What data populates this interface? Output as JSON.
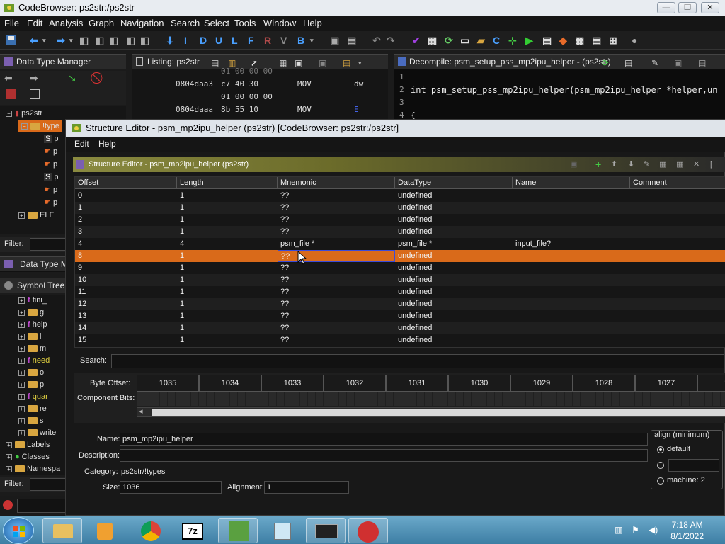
{
  "window": {
    "title": "CodeBrowser: ps2str:/ps2str"
  },
  "menubar": {
    "items": [
      "File",
      "Edit",
      "Analysis",
      "Graph",
      "Navigation",
      "Search",
      "Select",
      "Tools",
      "Window",
      "Help"
    ]
  },
  "toolbar": {
    "nav_letters": [
      "I",
      "D",
      "U",
      "L",
      "F",
      "R",
      "V",
      "B"
    ]
  },
  "panels": {
    "data_type_manager": "Data Type Manager",
    "data_type_manager_collapsed": "Data Type Ma",
    "listing": "Listing:  ps2str",
    "decompile": "Decompile: psm_setup_pss_mp2ipu_helper - (ps2str)",
    "symbol_tree": "Symbol Tree"
  },
  "dtm_tree": {
    "root": "ps2str",
    "types": "!type",
    "leaf_labels": [
      "p",
      "p",
      "p",
      "p",
      "p",
      "p"
    ],
    "elf": "ELF",
    "filter_label": "Filter:"
  },
  "listing": {
    "lines": [
      {
        "addr": "",
        "bytes": "01 00 00 00",
        "mnem": "",
        "op": ""
      },
      {
        "addr": "0804daa3",
        "bytes": "c7 40 30",
        "mnem": "MOV",
        "op": "dw"
      },
      {
        "addr": "",
        "bytes": "01 00 00 00",
        "mnem": "",
        "op": ""
      },
      {
        "addr": "0804daaa",
        "bytes": "8b 55 10",
        "mnem": "MOV",
        "op": "E"
      }
    ]
  },
  "decompile": {
    "lines": [
      {
        "no": "1",
        "code": ""
      },
      {
        "no": "2",
        "code": "int psm_setup_pss_mp2ipu_helper(psm_mp2ipu_helper *helper,un"
      },
      {
        "no": "3",
        "code": ""
      },
      {
        "no": "4",
        "code": "{"
      }
    ]
  },
  "symbol_tree": {
    "items": [
      "fini_",
      "g",
      "help",
      "i",
      "m",
      "need",
      "o",
      "p",
      "quar",
      "re",
      "s",
      "write",
      "Labels",
      "Classes",
      "Namespa"
    ],
    "filter_label": "Filter:"
  },
  "dialog": {
    "title": "Structure Editor - psm_mp2ipu_helper (ps2str) [CodeBrowser: ps2str:/ps2str]",
    "menu": [
      "Edit",
      "Help"
    ],
    "header": "Structure Editor - psm_mp2ipu_helper (ps2str)",
    "columns": [
      "Offset",
      "Length",
      "Mnemonic",
      "DataType",
      "Name",
      "Comment"
    ],
    "rows": [
      {
        "offset": "0",
        "length": "1",
        "mnemonic": "??",
        "datatype": "undefined",
        "name": "",
        "comment": ""
      },
      {
        "offset": "1",
        "length": "1",
        "mnemonic": "??",
        "datatype": "undefined",
        "name": "",
        "comment": ""
      },
      {
        "offset": "2",
        "length": "1",
        "mnemonic": "??",
        "datatype": "undefined",
        "name": "",
        "comment": ""
      },
      {
        "offset": "3",
        "length": "1",
        "mnemonic": "??",
        "datatype": "undefined",
        "name": "",
        "comment": ""
      },
      {
        "offset": "4",
        "length": "4",
        "mnemonic": "psm_file *",
        "datatype": "psm_file *",
        "name": "input_file?",
        "comment": ""
      },
      {
        "offset": "8",
        "length": "1",
        "mnemonic": "??",
        "datatype": "undefined",
        "name": "",
        "comment": ""
      },
      {
        "offset": "9",
        "length": "1",
        "mnemonic": "??",
        "datatype": "undefined",
        "name": "",
        "comment": ""
      },
      {
        "offset": "10",
        "length": "1",
        "mnemonic": "??",
        "datatype": "undefined",
        "name": "",
        "comment": ""
      },
      {
        "offset": "11",
        "length": "1",
        "mnemonic": "??",
        "datatype": "undefined",
        "name": "",
        "comment": ""
      },
      {
        "offset": "12",
        "length": "1",
        "mnemonic": "??",
        "datatype": "undefined",
        "name": "",
        "comment": ""
      },
      {
        "offset": "13",
        "length": "1",
        "mnemonic": "??",
        "datatype": "undefined",
        "name": "",
        "comment": ""
      },
      {
        "offset": "14",
        "length": "1",
        "mnemonic": "??",
        "datatype": "undefined",
        "name": "",
        "comment": ""
      },
      {
        "offset": "15",
        "length": "1",
        "mnemonic": "??",
        "datatype": "undefined",
        "name": "",
        "comment": ""
      }
    ],
    "selected_offset": "8",
    "search_label": "Search:",
    "byte_offset_label": "Byte Offset:",
    "component_bits_label": "Component Bits:",
    "byte_offsets": [
      "1035",
      "1034",
      "1033",
      "1032",
      "1031",
      "1030",
      "1029",
      "1028",
      "1027",
      "10"
    ],
    "name_label": "Name:",
    "name_value": "psm_mp2ipu_helper",
    "description_label": "Description:",
    "description_value": "",
    "category_label": "Category:",
    "category_value": "ps2str/!types",
    "size_label": "Size:",
    "size_value": "1036",
    "alignment_label": "Alignment:",
    "alignment_value": "1",
    "align_group_title": "align (minimum)",
    "align_options": [
      "default",
      "",
      "machine: 2"
    ]
  },
  "taskbar": {
    "time": "7:18 AM",
    "date": "8/1/2022"
  },
  "colors": {
    "selection": "#d96a1a",
    "background": "#181818"
  }
}
